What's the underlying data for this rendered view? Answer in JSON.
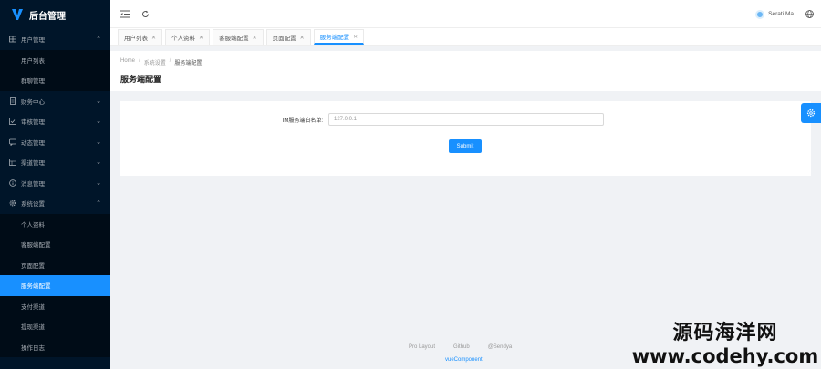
{
  "brand": {
    "title": "后台管理"
  },
  "sidebar": {
    "items": [
      {
        "label": "用户管理",
        "expanded": true,
        "icon": "table-icon",
        "children": [
          "用户列表",
          "群聊管理"
        ]
      },
      {
        "label": "财务中心",
        "icon": "doc-icon"
      },
      {
        "label": "审核管理",
        "icon": "check-icon"
      },
      {
        "label": "动态管理",
        "icon": "chat-icon"
      },
      {
        "label": "渠道管理",
        "icon": "grid-icon"
      },
      {
        "label": "消息管理",
        "icon": "info-icon"
      },
      {
        "label": "系统设置",
        "expanded": true,
        "icon": "gear-icon",
        "children": [
          "个人资料",
          "客服端配置",
          "页面配置",
          "服务端配置",
          "支付渠道",
          "提现渠道",
          "操作日志"
        ]
      }
    ],
    "active_child": "服务端配置"
  },
  "header": {
    "username": "Serati Ma"
  },
  "tabs": [
    {
      "label": "用户列表"
    },
    {
      "label": "个人资料"
    },
    {
      "label": "客服端配置"
    },
    {
      "label": "页面配置"
    },
    {
      "label": "服务端配置",
      "active": true
    }
  ],
  "breadcrumb": {
    "home": "Home",
    "parent": "系统设置",
    "current": "服务端配置"
  },
  "page": {
    "title": "服务端配置"
  },
  "form": {
    "label": "IM服务端白名单:",
    "value": "127.0.0.1",
    "submit": "Submit"
  },
  "footer": {
    "links": [
      "Pro Layout",
      "Github",
      "@Sendya"
    ],
    "copyright": "vueComponent"
  },
  "watermark": {
    "line1": "源码海洋网",
    "line2": "www.codehy.com"
  },
  "colors": {
    "sidebar_bg": "#001529",
    "accent": "#1890ff",
    "page_bg": "#f0f2f5"
  }
}
